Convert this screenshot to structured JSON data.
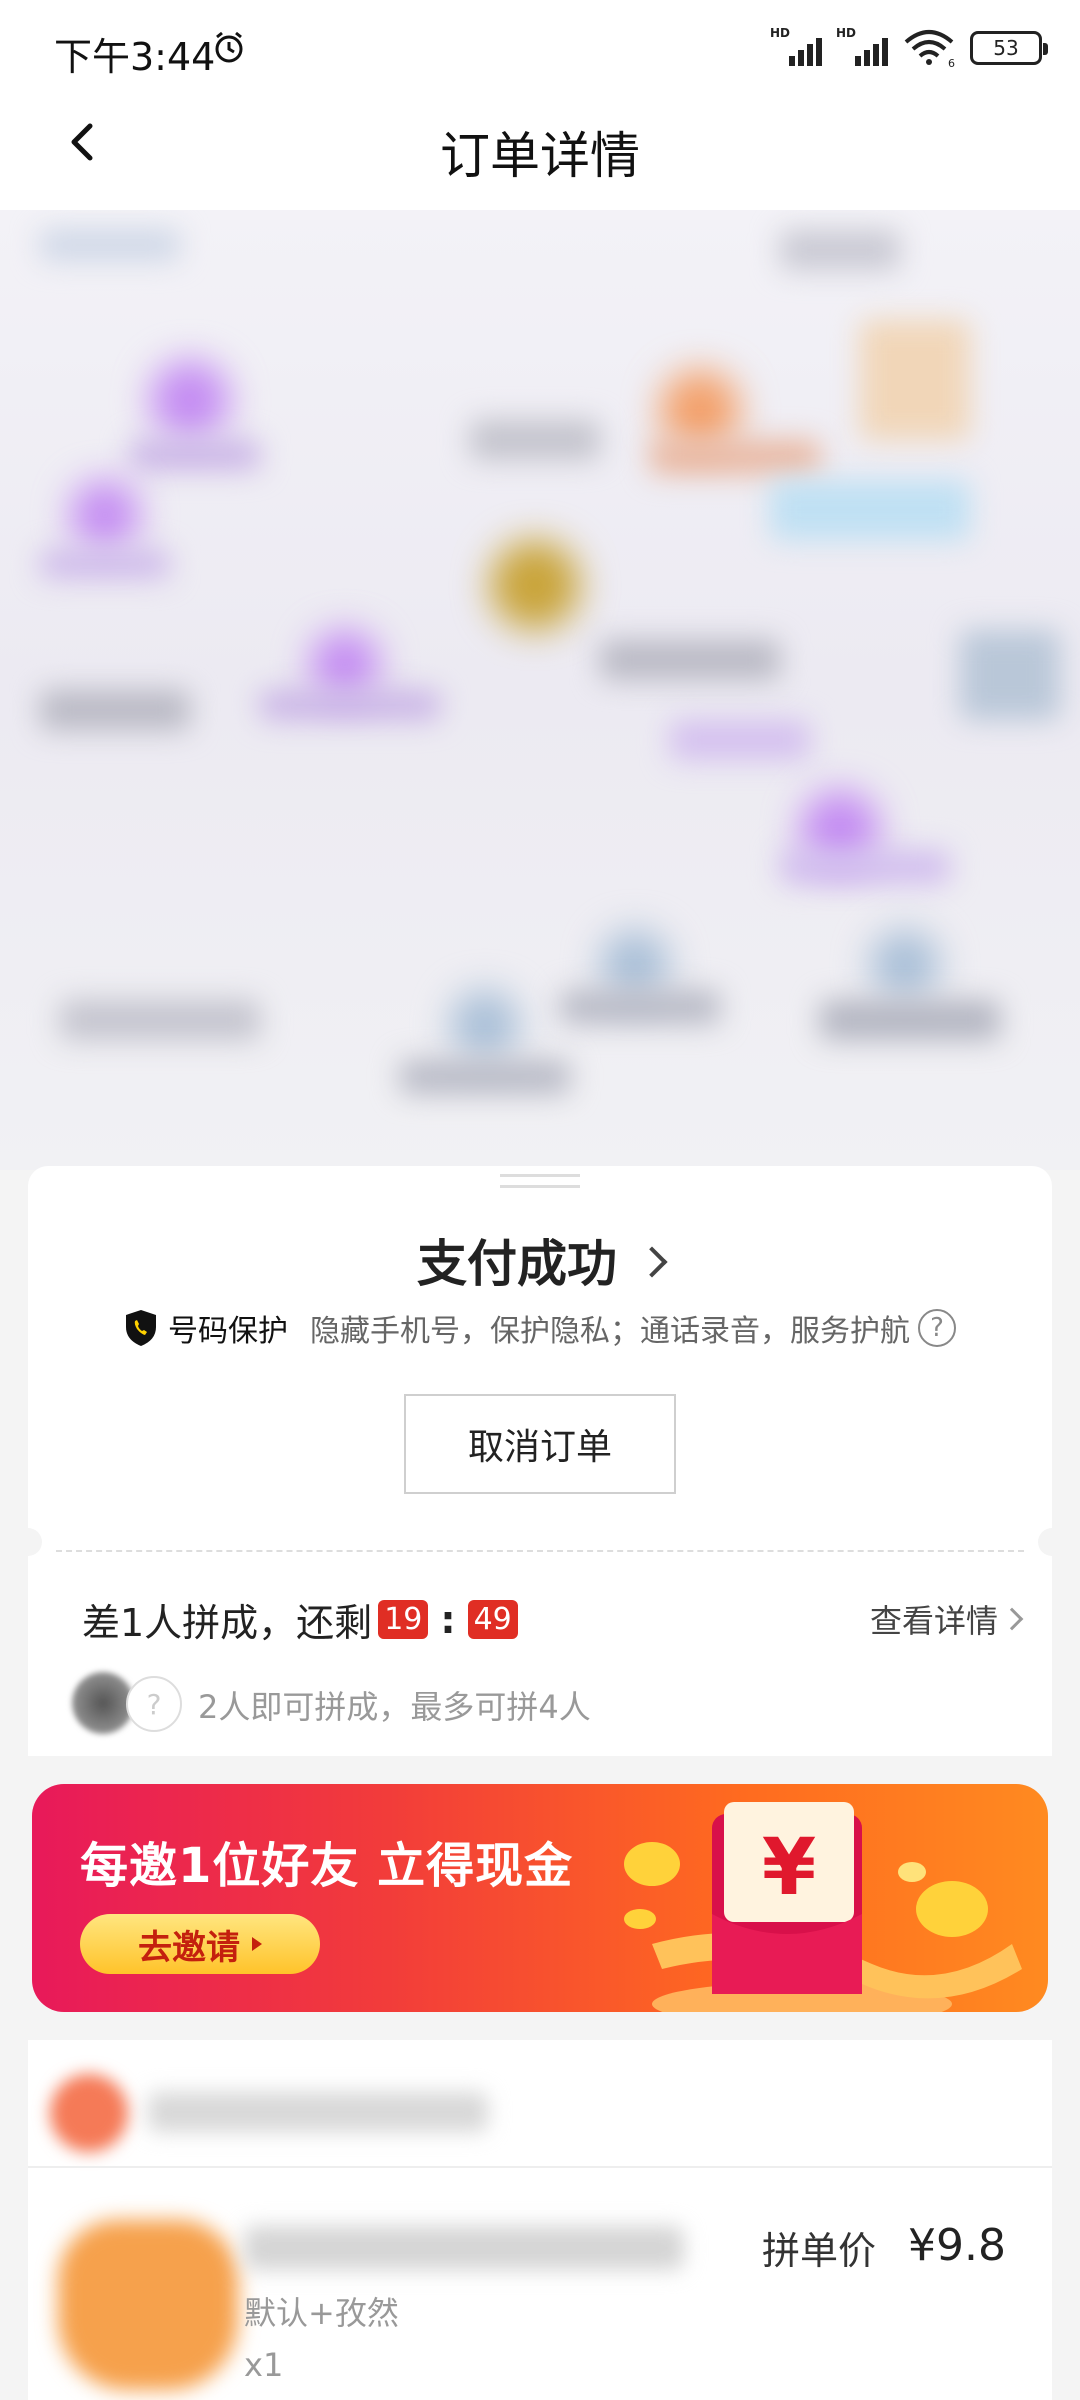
{
  "status_bar": {
    "time": "下午3:44",
    "signal1_label": "HD",
    "signal2_label": "HD",
    "wifi_label": "6",
    "battery": "53"
  },
  "nav": {
    "title": "订单详情"
  },
  "payment": {
    "status": "支付成功",
    "protect_title": "号码保护",
    "protect_desc": "隐藏手机号，保护隐私；通话录音，服务护航",
    "help_icon": "?",
    "cancel_label": "取消订单"
  },
  "group": {
    "title_prefix": "差1人拼成，还剩",
    "timer_min": "19",
    "timer_sep": ":",
    "timer_sec": "49",
    "detail_link": "查看详情",
    "empty_slot": "?",
    "hint": "2人即可拼成，最多可拼4人"
  },
  "banner": {
    "title": "每邀1位好友 立得现金",
    "button_label": "去邀请",
    "currency_symbol": "¥"
  },
  "product": {
    "price_label": "拼单价",
    "price_value": "¥9.8",
    "spec": "默认+孜然",
    "quantity": "x1"
  },
  "colors": {
    "accent_red": "#e02e24",
    "banner_start": "#e8195a",
    "banner_end": "#ff8a20"
  }
}
